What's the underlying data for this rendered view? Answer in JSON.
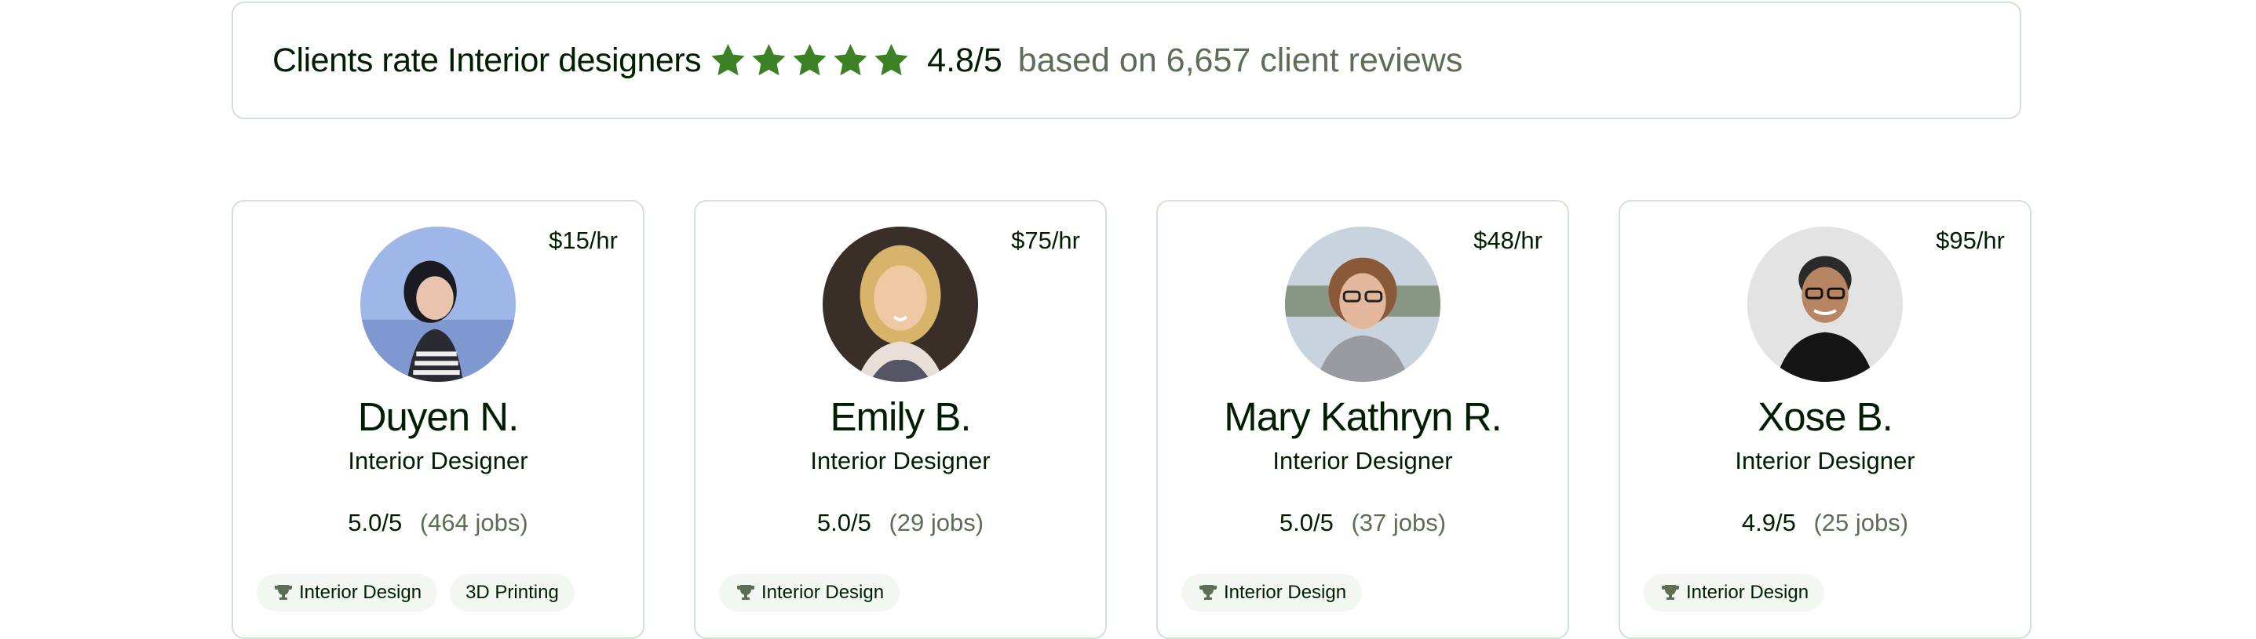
{
  "rating": {
    "title": "Clients rate Interior designers",
    "score": "4.8/5",
    "reviews": "based on 6,657 client reviews",
    "star_color": "#3c8224"
  },
  "freelancers": [
    {
      "rate": "$15/hr",
      "name": "Duyen N.",
      "title": "Interior Designer",
      "score": "5.0/5",
      "jobs": "(464 jobs)",
      "skills": [
        "Interior Design",
        "3D Printing"
      ]
    },
    {
      "rate": "$75/hr",
      "name": "Emily B.",
      "title": "Interior Designer",
      "score": "5.0/5",
      "jobs": "(29 jobs)",
      "skills": [
        "Interior Design"
      ]
    },
    {
      "rate": "$48/hr",
      "name": "Mary Kathryn R.",
      "title": "Interior Designer",
      "score": "5.0/5",
      "jobs": "(37 jobs)",
      "skills": [
        "Interior Design"
      ]
    },
    {
      "rate": "$95/hr",
      "name": "Xose B.",
      "title": "Interior Designer",
      "score": "4.9/5",
      "jobs": "(25 jobs)",
      "skills": [
        "Interior Design"
      ]
    }
  ]
}
